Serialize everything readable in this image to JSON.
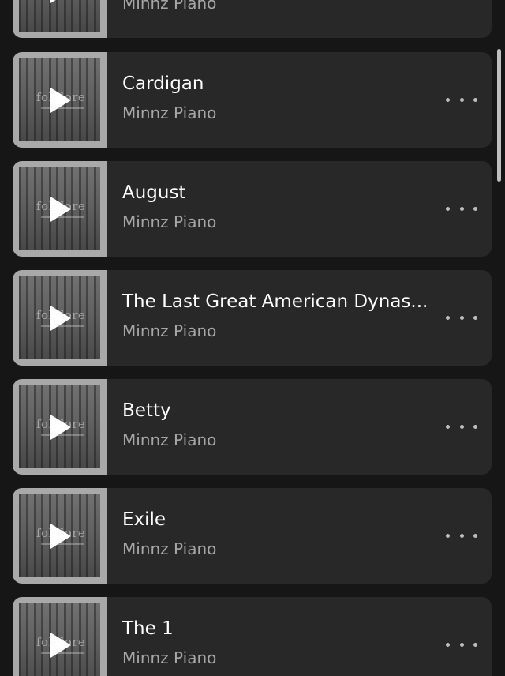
{
  "tracks": [
    {
      "title": "",
      "artist": "Minnz Piano"
    },
    {
      "title": "Cardigan",
      "artist": "Minnz Piano"
    },
    {
      "title": "August",
      "artist": "Minnz Piano"
    },
    {
      "title": "The Last Great American Dynas...",
      "artist": "Minnz Piano"
    },
    {
      "title": "Betty",
      "artist": "Minnz Piano"
    },
    {
      "title": "Exile",
      "artist": "Minnz Piano"
    },
    {
      "title": "The 1",
      "artist": "Minnz Piano"
    }
  ],
  "album_art_text": "folklore",
  "icons": {
    "play": "play-icon",
    "more": "more-horizontal-icon"
  },
  "colors": {
    "background": "#161616",
    "card": "#282828",
    "title": "#ffffff",
    "artist": "#a7a7a7"
  }
}
